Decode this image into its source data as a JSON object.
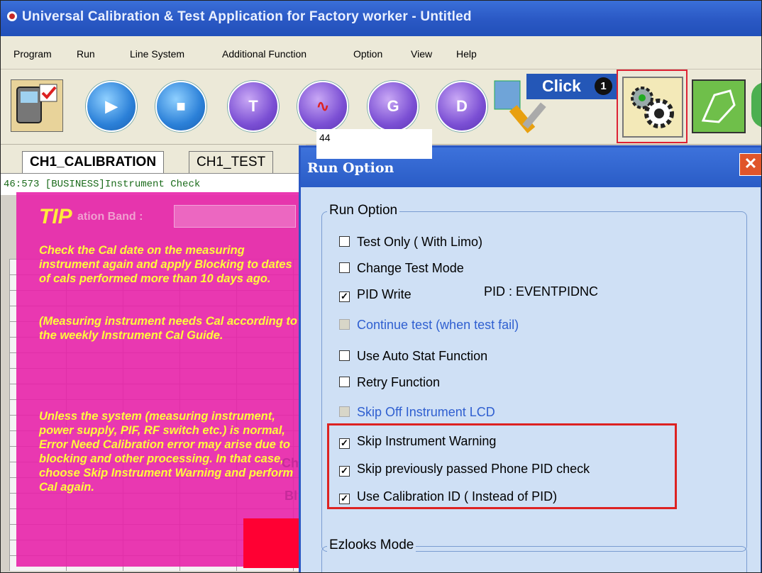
{
  "window": {
    "title": "Universal Calibration & Test Application for Factory worker - Untitled"
  },
  "menu": [
    "Program",
    "Run",
    "Line System",
    "Additional Function",
    "Option",
    "View",
    "Help"
  ],
  "toolbar": {
    "buttons": [
      {
        "name": "phone-calibration-icon"
      },
      {
        "name": "play-icon"
      },
      {
        "name": "stop-icon"
      },
      {
        "name": "test-t-icon"
      },
      {
        "name": "waveform-icon"
      },
      {
        "name": "g-icon"
      },
      {
        "name": "d-icon"
      },
      {
        "name": "tools-icon"
      },
      {
        "name": "gear-settings-icon"
      },
      {
        "name": "hand-document-icon"
      }
    ],
    "callout": {
      "label": "Click",
      "number": "1"
    }
  },
  "tabs": [
    "CH1_CALIBRATION",
    "CH1_TEST"
  ],
  "log_line": "46:573 [BUSINESS]Instrument Check",
  "tip": {
    "title": "TIP",
    "band_label": "ation Band :",
    "paragraph1": "Check the Cal date on the measuring instrument again and apply Blocking to dates of cals performed more than 10 days ago.",
    "paragraph2": "(Measuring instrument needs Cal according to the weekly Instrument Cal Guide.",
    "paragraph3": "Unless the system (measuring instrument, power supply, PIF, RF switch etc.) is normal, Error Need Calibration error may arise due to blocking and other processing. In that case, choose Skip Instrument Warning and perform Cal again.",
    "side_text_1": "Channe",
    "side_text_2": "Bl"
  },
  "dialog": {
    "title": "Run Option",
    "close": "✕",
    "group_label": "Run Option",
    "options": [
      {
        "label": "Test Only ( With Limo)",
        "checked": false,
        "enabled": true
      },
      {
        "label": "Change Test Mode",
        "checked": false,
        "enabled": true
      },
      {
        "label": "PID Write",
        "checked": true,
        "enabled": true
      },
      {
        "label": "Continue test (when test fail)",
        "checked": false,
        "enabled": false
      },
      {
        "label": "Use Auto Stat Function",
        "checked": false,
        "enabled": true
      },
      {
        "label": "Retry Function",
        "checked": false,
        "enabled": true
      },
      {
        "label": "Skip Off Instrument LCD",
        "checked": false,
        "enabled": false
      },
      {
        "label": "Skip Instrument Warning",
        "checked": true,
        "enabled": true
      },
      {
        "label": "Skip previously passed Phone PID check",
        "checked": true,
        "enabled": true
      },
      {
        "label": "Use Calibration ID ( Instead of PID)",
        "checked": true,
        "enabled": true
      }
    ],
    "pid_label": "PID :  EVENTPIDNC",
    "pid_value": "44",
    "group2_label": "Ezlooks Mode"
  }
}
